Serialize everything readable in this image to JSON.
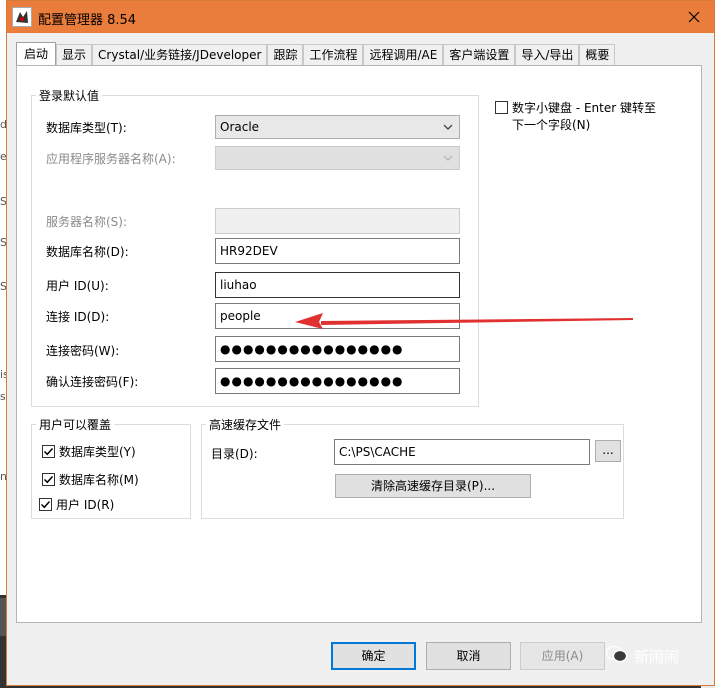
{
  "window": {
    "title": "配置管理器 8.54",
    "close_glyph": "✕"
  },
  "tabs": [
    {
      "label": "启动"
    },
    {
      "label": "显示"
    },
    {
      "label": "Crystal/业务链接/JDeveloper"
    },
    {
      "label": "跟踪"
    },
    {
      "label": "工作流程"
    },
    {
      "label": "远程调用/AE"
    },
    {
      "label": "客户端设置"
    },
    {
      "label": "导入/导出"
    },
    {
      "label": "概要"
    }
  ],
  "login_defaults": {
    "group_label": "登录默认值",
    "db_type_label": "数据库类型(T):",
    "db_type_value": "Oracle",
    "app_server_label": "应用程序服务器名称(A):",
    "app_server_value": "",
    "server_name_label": "服务器名称(S):",
    "server_name_value": "",
    "db_name_label": "数据库名称(D):",
    "db_name_value": "HR92DEV",
    "user_id_label": "用户 ID(U):",
    "user_id_value": "liuhao",
    "connect_id_label": "连接 ID(D):",
    "connect_id_value": "people",
    "connect_pw_label": "连接密码(W):",
    "connect_pw_value": "●●●●●●●●●●●●●●●●",
    "confirm_pw_label": "确认连接密码(F):",
    "confirm_pw_value": "●●●●●●●●●●●●●●●●"
  },
  "numpad_option": {
    "label_line1": "数字小键盘 - Enter 键转至",
    "label_line2": "下一个字段(N)",
    "checked": false
  },
  "user_override": {
    "group_label": "用户可以覆盖",
    "items": [
      {
        "label": "数据库类型(Y)",
        "checked": true
      },
      {
        "label": "数据库名称(M)",
        "checked": true
      },
      {
        "label": "用户 ID(R)",
        "checked": true
      }
    ]
  },
  "cache": {
    "group_label": "高速缓存文件",
    "dir_label": "目录(D):",
    "dir_value": "C:\\PS\\CACHE",
    "browse_label": "...",
    "purge_label": "清除高速缓存目录(P)..."
  },
  "footer": {
    "ok_label": "确定",
    "cancel_label": "取消",
    "apply_label": "应用(A)"
  },
  "watermark": {
    "text": "新闹闹"
  },
  "background": {
    "left_fragments": [
      "d",
      "e",
      "S",
      "S",
      "S",
      "is",
      "s",
      "n"
    ]
  },
  "colors": {
    "titlebar": "#ea7d3c",
    "arrow": "#e03030",
    "primary_border": "#0078d7"
  }
}
